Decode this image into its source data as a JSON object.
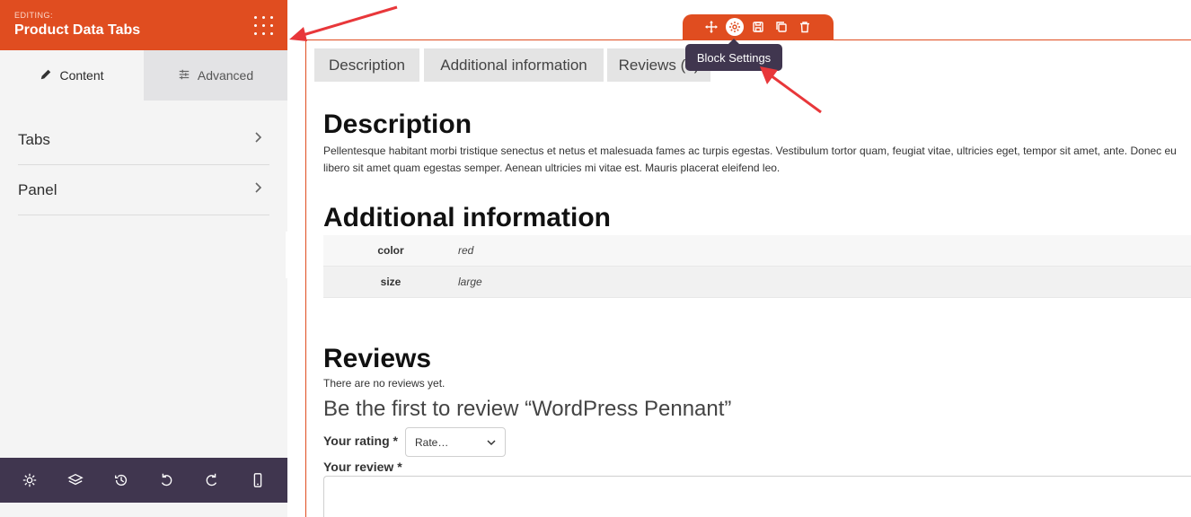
{
  "sidebar": {
    "editing_label": "EDITING:",
    "title": "Product Data Tabs",
    "tabs": [
      {
        "label": "Content",
        "icon": "pencil-icon"
      },
      {
        "label": "Advanced",
        "icon": "sliders-icon"
      }
    ],
    "sections": [
      {
        "label": "Tabs"
      },
      {
        "label": "Panel"
      }
    ],
    "footer_icons": [
      "gear-icon",
      "layers-icon",
      "history-icon",
      "undo-icon",
      "redo-icon",
      "mobile-icon"
    ]
  },
  "toolbar": {
    "icons": [
      "move-icon",
      "gear-icon",
      "save-icon",
      "duplicate-icon",
      "trash-icon"
    ],
    "tooltip": "Block Settings"
  },
  "product_tabs": [
    "Description",
    "Additional information",
    "Reviews (0)"
  ],
  "description": {
    "heading": "Description",
    "text": "Pellentesque habitant morbi tristique senectus et netus et malesuada fames ac turpis egestas. Vestibulum tortor quam, feugiat vitae, ultricies eget, tempor sit amet, ante. Donec eu libero sit amet quam egestas semper. Aenean ultricies mi vitae est. Mauris placerat eleifend leo."
  },
  "additional": {
    "heading": "Additional information",
    "rows": [
      {
        "name": "color",
        "value": "red"
      },
      {
        "name": "size",
        "value": "large"
      }
    ]
  },
  "reviews": {
    "heading": "Reviews",
    "none_text": "There are no reviews yet.",
    "be_first": "Be the first to review “WordPress Pennant”",
    "rating_label": "Your rating *",
    "rating_select": "Rate…",
    "review_label": "Your review *"
  },
  "colors": {
    "accent": "#e04d20",
    "dark": "#40364f",
    "arrow": "#e8373a"
  }
}
